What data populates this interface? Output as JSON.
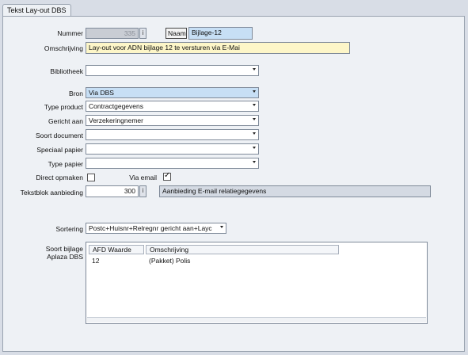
{
  "tab": {
    "label": "Tekst Lay-out DBS"
  },
  "form": {
    "nummer": {
      "label": "Nummer",
      "value": "335",
      "spin": "i"
    },
    "naam": {
      "label": "Naam",
      "value": "Bijlage-12"
    },
    "omschrijving": {
      "label": "Omschrijving",
      "value": "Lay-out voor ADN bijlage 12 te versturen via E-Mai"
    },
    "bibliotheek": {
      "label": "Bibliotheek",
      "value": ""
    },
    "bron": {
      "label": "Bron",
      "value": "Via DBS"
    },
    "type_product": {
      "label": "Type product",
      "value": "Contractgegevens"
    },
    "gericht_aan": {
      "label": "Gericht aan",
      "value": "Verzekeringnemer"
    },
    "soort_document": {
      "label": "Soort document",
      "value": ""
    },
    "speciaal_papier": {
      "label": "Speciaal papier",
      "value": ""
    },
    "type_papier": {
      "label": "Type papier",
      "value": ""
    },
    "direct_opmaken": {
      "label": "Direct opmaken",
      "checked": false
    },
    "via_email": {
      "label": "Via email",
      "checked": true
    },
    "tekstblok": {
      "label": "Tekstblok aanbieding",
      "value": "300",
      "spin": "i",
      "description": "Aanbieding E-mail relatiegegevens"
    },
    "sortering": {
      "label": "Sortering",
      "value": "Postc+Huisnr+Relregnr gericht aan+Layc"
    },
    "soort_bijlage": {
      "label_line1": "Soort bijlage",
      "label_line2": "Aplaza DBS",
      "columns": [
        "AFD Waarde",
        "Omschrijving"
      ],
      "rows": [
        {
          "afd_waarde": "12",
          "omschrijving": "(Pakket) Polis"
        }
      ]
    }
  }
}
